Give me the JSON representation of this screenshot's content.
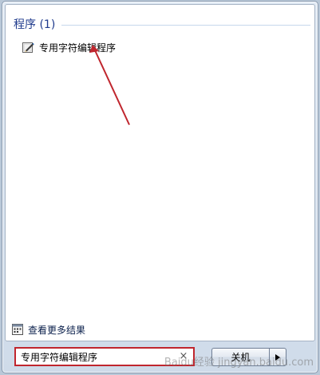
{
  "results": {
    "group_title": "程序 (1)",
    "items": [
      {
        "label": "专用字符编辑程序",
        "icon": "eudc-editor-icon"
      }
    ],
    "see_more_label": "查看更多结果"
  },
  "search": {
    "value": "专用字符编辑程序",
    "clear_symbol": "×"
  },
  "shutdown": {
    "label": "关机"
  },
  "annotation": {
    "color": "#c0262e"
  },
  "watermark": "Baidu经验 jingyan.baidu.com"
}
